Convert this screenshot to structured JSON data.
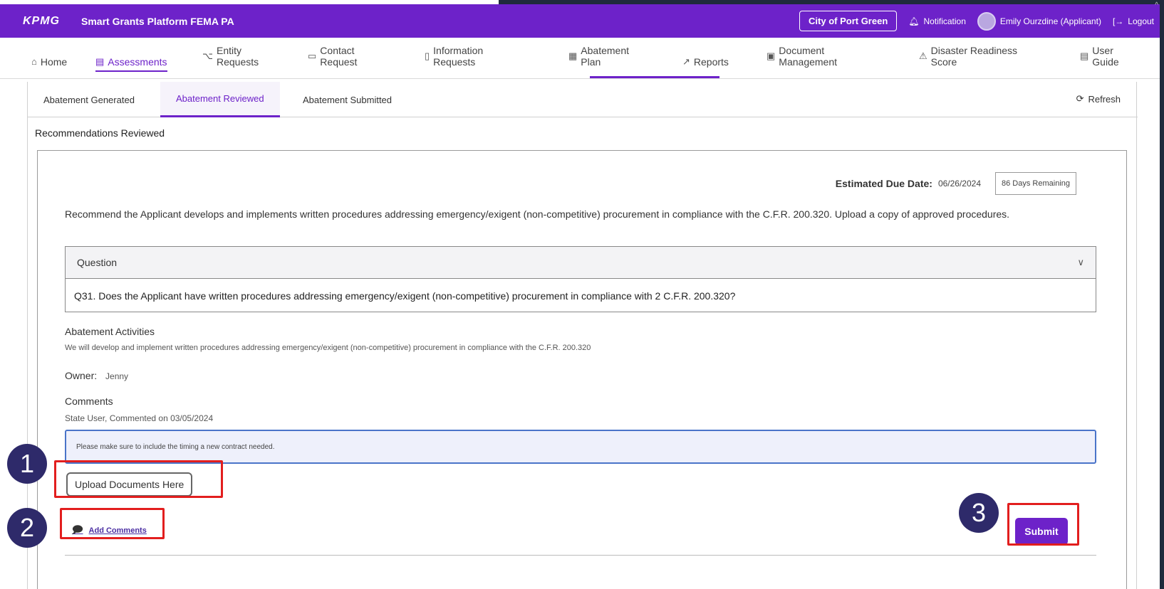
{
  "header": {
    "logo": "KPMG",
    "title": "Smart Grants Platform FEMA PA",
    "city": "City of Port Green",
    "notification": "Notification",
    "user": "Emily Ourzdine (Applicant)",
    "logout": "Logout"
  },
  "nav": {
    "home": "Home",
    "assessments": "Assessments",
    "entity_1": "Entity",
    "entity_2": "Requests",
    "contact_1": "Contact",
    "contact_2": "Request",
    "info_1": "Information",
    "info_2": "Requests",
    "abatement_1": "Abatement",
    "abatement_2": "Plan",
    "reports": "Reports",
    "docs_1": "Document",
    "docs_2": "Management",
    "drs_1": "Disaster Readiness",
    "drs_2": "Score",
    "guide_1": "User",
    "guide_2": "Guide"
  },
  "subtabs": {
    "generated": "Abatement Generated",
    "reviewed": "Abatement Reviewed",
    "submitted": "Abatement Submitted",
    "refresh": "Refresh"
  },
  "section_title": "Recommendations Reviewed",
  "card": {
    "due_label": "Estimated Due Date:",
    "due_date": "06/26/2024",
    "days_remaining": "86 Days Remaining",
    "recommendation": "Recommend the Applicant develops and implements written procedures addressing emergency/exigent (non-competitive) procurement in compliance with the C.F.R. 200.320. Upload a copy of approved procedures.",
    "question_header": "Question",
    "question_text": "Q31. Does the Applicant have written procedures addressing emergency/exigent (non-competitive) procurement in compliance with 2 C.F.R. 200.320?",
    "activities_label": "Abatement Activities",
    "activities_text": "We will develop and implement written procedures addressing emergency/exigent (non-competitive) procurement in compliance with the C.F.R. 200.320",
    "owner_label": "Owner:",
    "owner_value": "Jenny",
    "comments_label": "Comments",
    "comment_meta": "State User,  Commented on 03/05/2024",
    "comment_text": "Please make sure to include the timing a new contract needed.",
    "upload_label": "Upload Documents Here",
    "add_comments_label": "Add Comments",
    "submit_label": "Submit"
  },
  "callouts": [
    "1",
    "2",
    "3"
  ],
  "colors": {
    "brand": "#6d22c9",
    "highlight": "#e21e1e",
    "callout": "#2e2a6a"
  }
}
